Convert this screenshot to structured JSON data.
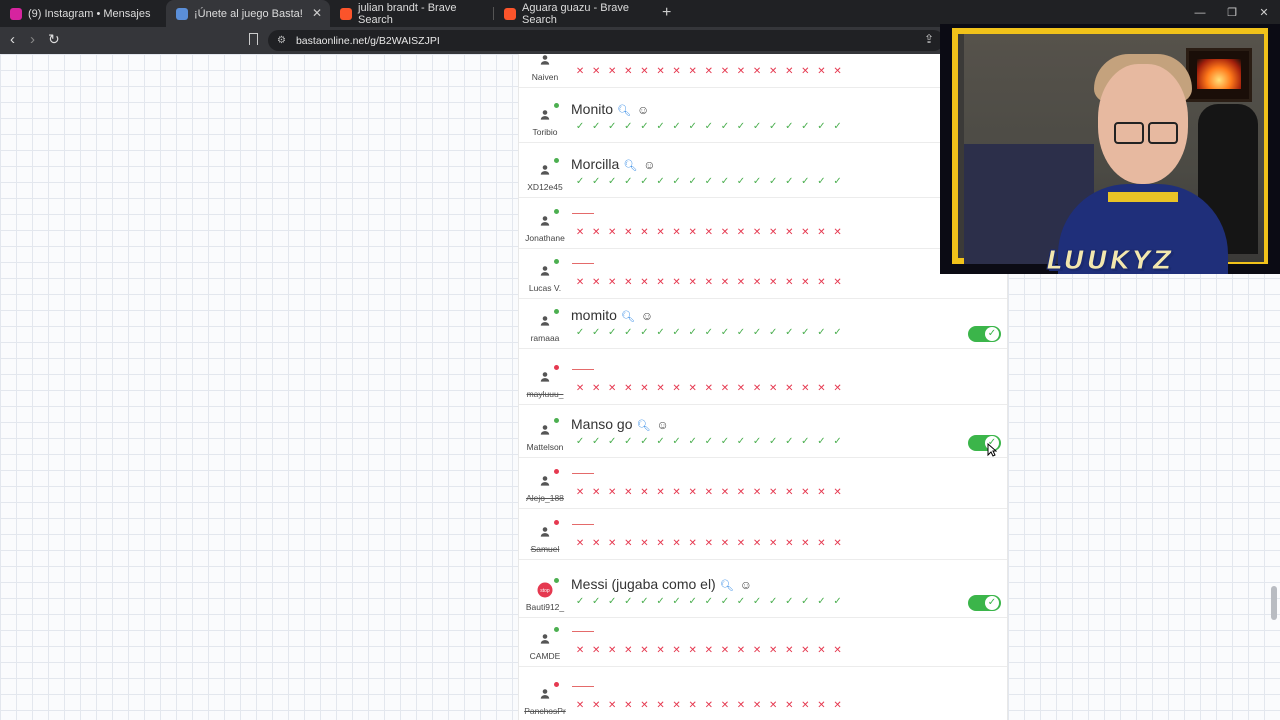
{
  "browser": {
    "tabs": [
      {
        "title": "(9) Instagram • Mensajes",
        "active": false,
        "icon": "instagram-icon",
        "color": "#d6249f"
      },
      {
        "title": "¡Únete al juego Basta!",
        "active": true,
        "icon": "basta-icon",
        "color": "#5b8fd9"
      },
      {
        "title": "julian brandt - Brave Search",
        "active": false,
        "icon": "brave-icon",
        "color": "#fb542b"
      },
      {
        "title": "Aguara guazu - Brave Search",
        "active": false,
        "icon": "brave-icon",
        "color": "#fb542b"
      }
    ],
    "url": "bastaonline.net/g/B2WAISZJPI",
    "new_tab": "+",
    "close": "✕",
    "back": "‹",
    "forward": "›",
    "reload": "↻",
    "share": "⇪",
    "window_controls": [
      "—",
      "❐",
      "✕"
    ],
    "site_info": "⚙"
  },
  "rows": [
    {
      "user": "Naiven",
      "answer": "",
      "status": "wrong",
      "dot": "#4caf50",
      "struck": false,
      "validated": false
    },
    {
      "user": "Toribio",
      "answer": "Monito",
      "status": "correct",
      "dot": "#4caf50",
      "struck": false,
      "validated": false
    },
    {
      "user": "XD12e45",
      "answer": "Morcilla",
      "status": "correct",
      "dot": "#4caf50",
      "struck": false,
      "validated": false
    },
    {
      "user": "Jonathane",
      "answer": "",
      "status": "wrong",
      "dot": "#4caf50",
      "struck": false,
      "validated": false
    },
    {
      "user": "Lucas V.",
      "answer": "",
      "status": "wrong",
      "dot": "#4caf50",
      "struck": false,
      "validated": false
    },
    {
      "user": "ramaaa",
      "answer": "momito",
      "status": "correct",
      "dot": "#4caf50",
      "struck": false,
      "validated": true
    },
    {
      "user": "mayluuu_",
      "answer": "",
      "status": "wrong",
      "dot": "#e53950",
      "struck": true,
      "validated": false
    },
    {
      "user": "Mattelson",
      "answer": "Manso go",
      "status": "correct",
      "dot": "#4caf50",
      "struck": false,
      "validated": true
    },
    {
      "user": "Alejo_188",
      "answer": "",
      "status": "wrong",
      "dot": "#e53950",
      "struck": true,
      "validated": false
    },
    {
      "user": "Samuel",
      "answer": "",
      "status": "wrong",
      "dot": "#e53950",
      "struck": true,
      "validated": false
    },
    {
      "user": "Bauti912_",
      "answer": "Messi (jugaba como el)",
      "status": "correct",
      "dot": "#4caf50",
      "struck": false,
      "validated": true
    },
    {
      "user": "CAMDE",
      "answer": "",
      "status": "wrong",
      "dot": "#4caf50",
      "struck": false,
      "validated": false
    },
    {
      "user": "PanchosPr",
      "answer": "",
      "status": "wrong",
      "dot": "#e53950",
      "struck": true,
      "validated": false
    }
  ],
  "marks_per_row": 17,
  "webcam": {
    "overlay_name": "LUUKYZ"
  },
  "colors": {
    "correct": "#4caf50",
    "wrong": "#e53950",
    "toggle": "#3bb54a",
    "webcam_border": "#f1c21a"
  }
}
